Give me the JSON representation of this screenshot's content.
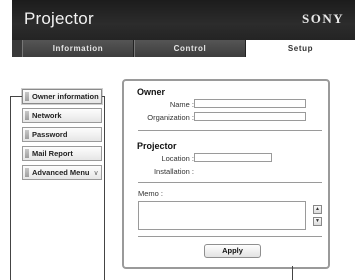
{
  "header": {
    "title": "Projector",
    "brand": "SONY"
  },
  "tabs": [
    {
      "label": "Information"
    },
    {
      "label": "Control"
    },
    {
      "label": "Setup"
    }
  ],
  "sidebar": {
    "items": [
      {
        "label": "Owner information"
      },
      {
        "label": "Network"
      },
      {
        "label": "Password"
      },
      {
        "label": "Mail Report"
      },
      {
        "label": "Advanced Menu"
      }
    ],
    "advanced_chevron": "chevron-down-icon"
  },
  "form": {
    "owner": {
      "title": "Owner",
      "name_label": "Name :",
      "name_value": "",
      "organization_label": "Organization :",
      "organization_value": ""
    },
    "projector": {
      "title": "Projector",
      "location_label": "Location :",
      "location_value": "",
      "installation_label": "Installation :"
    },
    "memo": {
      "label": "Memo :",
      "value": ""
    },
    "apply_label": "Apply"
  }
}
